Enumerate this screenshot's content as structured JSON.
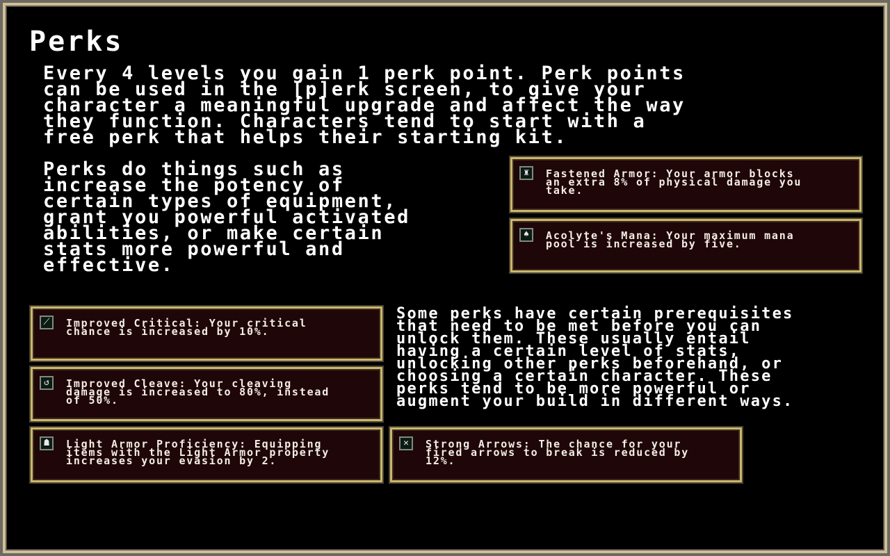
{
  "title": "Perks",
  "paragraphs": {
    "intro": "Every 4 levels you gain 1 perk point. Perk points\ncan be used in the [p]erk screen, to give your\ncharacter a meaningful upgrade and affect the way\nthey function. Characters tend to start with a\nfree perk that helps their starting kit.",
    "examples": "Perks do things such as\nincrease the potency of\ncertain types of equipment,\ngrant you powerful activated\nabilities, or make certain\nstats more powerful and\neffective.",
    "prereqs": "Some perks have certain prerequisites\nthat need to be met before you can\nunlock them. These usually entail\nhaving a certain level of stats,\nunlocking other perks beforehand, or\nchoosing a certain character. These\nperks tend to be more powerful or\naugment your build in different ways."
  },
  "perks": [
    {
      "icon": "helmet-icon",
      "glyph": "♜",
      "text": "Fastened Armor: Your armor blocks\nan extra 8% of physical damage you\ntake."
    },
    {
      "icon": "candle-icon",
      "glyph": "♠",
      "text": "Acolyte's Mana: Your maximum mana\npool is increased by five."
    },
    {
      "icon": "sword-icon",
      "glyph": "⟋",
      "text": "Improved Critical: Your critical\nchance is increased by 10%."
    },
    {
      "icon": "cleave-icon",
      "glyph": "↺",
      "text": "Improved Cleave: Your cleaving\ndamage is increased to 80%, instead\nof 50%."
    },
    {
      "icon": "hood-icon",
      "glyph": "☗",
      "text": "Light Armor Proficiency: Equipping\nitems with the Light Armor property\nincreases your evasion by 2."
    },
    {
      "icon": "arrows-icon",
      "glyph": "✕",
      "text": "Strong Arrows: The chance for your\nfired arrows to break is reduced by\n12%."
    }
  ],
  "colors": {
    "panel_bg": "#1f0608",
    "panel_border": "#cbb76a",
    "frame_border": "#cdbf99"
  }
}
